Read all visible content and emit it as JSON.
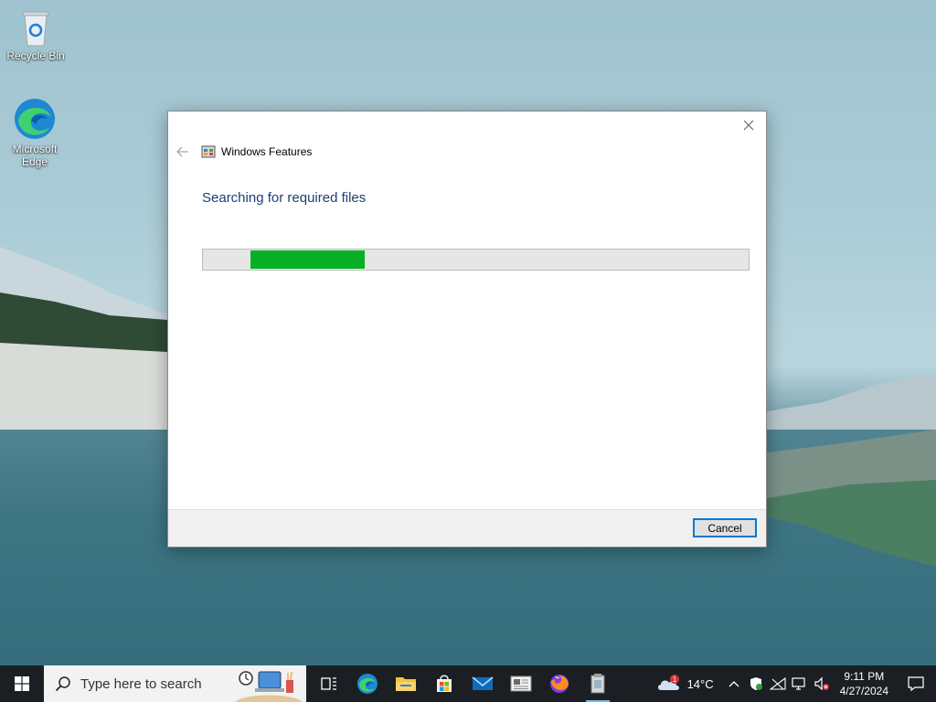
{
  "desktop": {
    "icons": [
      {
        "label": "Recycle Bin",
        "icon": "recycle-bin-icon"
      },
      {
        "label": "Microsoft Edge",
        "icon": "edge-icon"
      }
    ]
  },
  "dialog": {
    "title": "Windows Features",
    "heading": "Searching for required files",
    "progress_fraction": 0.21,
    "progress_start_fraction": 0.087,
    "progress_color": "#06b025",
    "cancel_label": "Cancel"
  },
  "taskbar": {
    "search_placeholder": "Type here to search",
    "apps": [
      "task-view-icon",
      "edge-icon",
      "file-explorer-icon",
      "store-icon",
      "mail-icon",
      "news-icon",
      "firefox-icon",
      "installer-icon"
    ],
    "weather": {
      "temperature": "14°C",
      "badge": "1"
    },
    "clock": {
      "time": "9:11 PM",
      "date": "4/27/2024"
    }
  },
  "colors": {
    "accent": "#0078d7",
    "heading_text": "#1e3f73",
    "taskbar": "#1b1f24"
  }
}
